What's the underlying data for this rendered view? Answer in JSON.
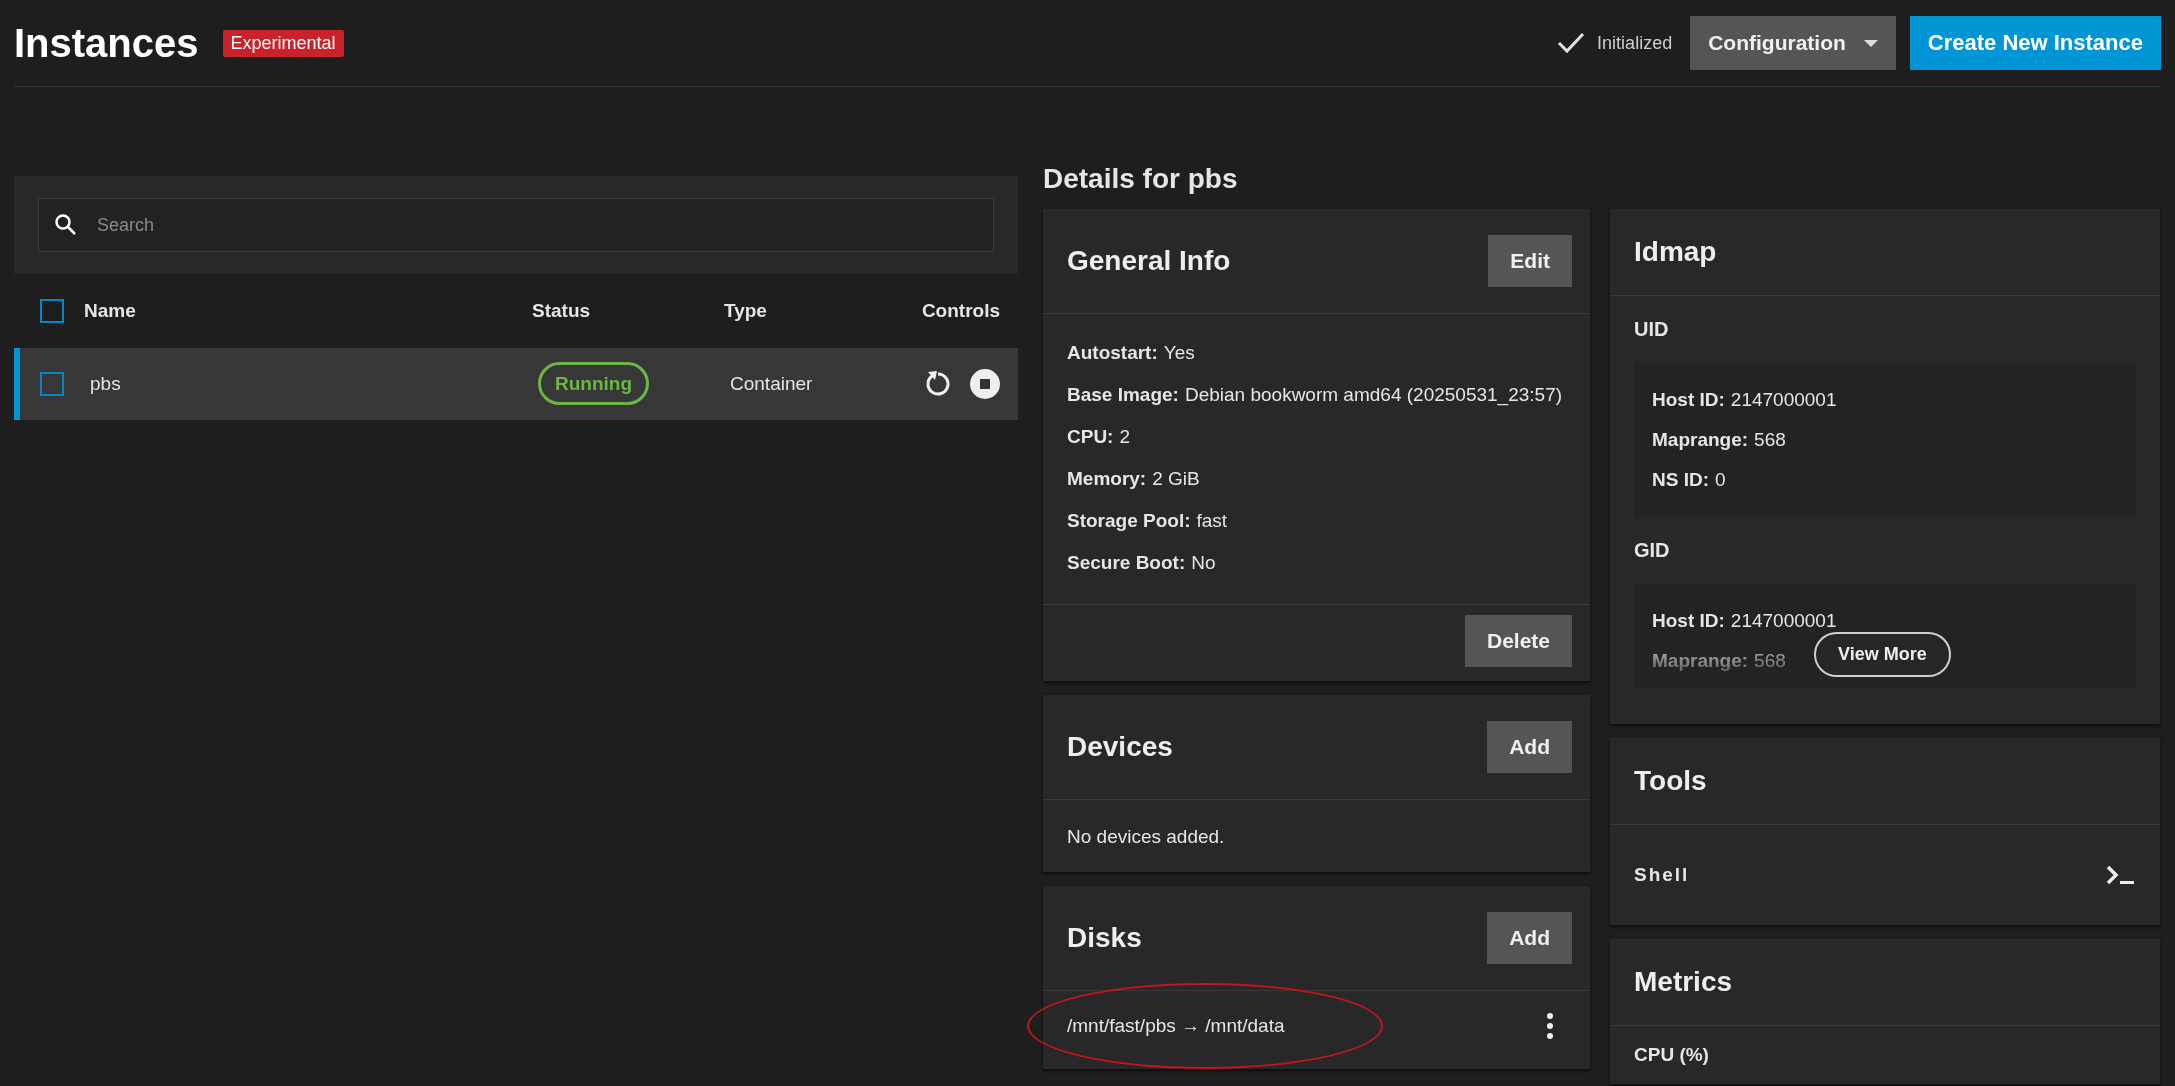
{
  "header": {
    "title": "Instances",
    "badge": "Experimental",
    "status": {
      "text": "Initialized",
      "kind": "ok"
    },
    "config_button": "Configuration",
    "create_button": "Create New Instance"
  },
  "instances": {
    "search": {
      "placeholder": "Search"
    },
    "select_all_checked": false,
    "columns": [
      "Name",
      "Status",
      "Type",
      "Controls"
    ],
    "rows": [
      {
        "name": "pbs",
        "status": "Running",
        "type": "Container",
        "checked": false,
        "selected": true
      }
    ]
  },
  "details": {
    "title": "Details for pbs",
    "general_info": {
      "title": "General Info",
      "edit_button": "Edit",
      "fields": [
        {
          "label": "Autostart:",
          "value": "Yes"
        },
        {
          "label": "Base Image:",
          "value": "Debian bookworm amd64 (20250531_23:57)"
        },
        {
          "label": "CPU:",
          "value": "2"
        },
        {
          "label": "Memory:",
          "value": "2 GiB"
        },
        {
          "label": "Storage Pool:",
          "value": "fast"
        },
        {
          "label": "Secure Boot:",
          "value": "No"
        }
      ],
      "delete_button": "Delete"
    },
    "devices": {
      "title": "Devices",
      "add_button": "Add",
      "empty_text": "No devices added."
    },
    "disks": {
      "title": "Disks",
      "add_button": "Add",
      "items": [
        {
          "text": "/mnt/fast/pbs → /mnt/data",
          "circled": true
        }
      ]
    },
    "idmap": {
      "title": "Idmap",
      "groups": [
        {
          "title": "UID",
          "collapsed": false,
          "fields": [
            {
              "label": "Host ID:",
              "value": "2147000001"
            },
            {
              "label": "Maprange:",
              "value": "568"
            },
            {
              "label": "NS ID:",
              "value": "0"
            }
          ]
        },
        {
          "title": "GID",
          "collapsed": true,
          "fields": [
            {
              "label": "Host ID:",
              "value": "2147000001"
            },
            {
              "label": "Maprange:",
              "value": "568"
            }
          ]
        }
      ],
      "view_more_button": "View More"
    },
    "tools": {
      "title": "Tools",
      "items": [
        {
          "label": "Shell",
          "kind": "shell"
        }
      ]
    },
    "metrics": {
      "title": "Metrics",
      "items": [
        {
          "label": "CPU (%)"
        }
      ]
    }
  }
}
